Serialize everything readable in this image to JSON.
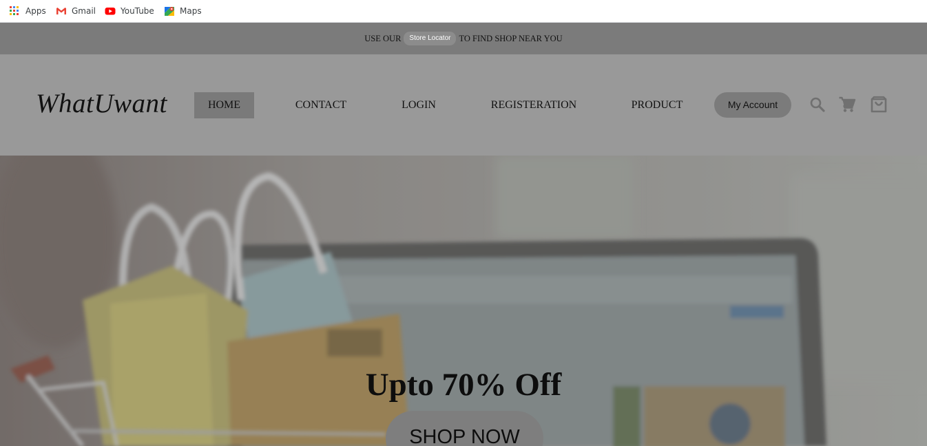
{
  "bookmarks": [
    {
      "label": "Apps",
      "icon": "apps-grid-icon"
    },
    {
      "label": "Gmail",
      "icon": "gmail-icon"
    },
    {
      "label": "YouTube",
      "icon": "youtube-icon"
    },
    {
      "label": "Maps",
      "icon": "maps-icon"
    }
  ],
  "promo": {
    "prefix": "USE OUR",
    "locator_label": "Store Locator",
    "suffix": "TO FIND SHOP NEAR YOU"
  },
  "header": {
    "logo": "WhatUwant",
    "nav": [
      {
        "label": "HOME",
        "active": true
      },
      {
        "label": "CONTACT"
      },
      {
        "label": "LOGIN"
      },
      {
        "label": "REGISTERATION"
      },
      {
        "label": "PRODUCT"
      }
    ],
    "account_label": "My Account",
    "icons": [
      "search-icon",
      "cart-icon",
      "shopping-bag-icon"
    ]
  },
  "hero": {
    "title": "Upto 70% Off",
    "cta": "SHOP NOW"
  },
  "colors": {
    "promo_bg": "#7b7b7b",
    "header_bg": "#999999",
    "active_nav_bg": "#7a7a7a",
    "button_bg": "#7b7b7b"
  }
}
